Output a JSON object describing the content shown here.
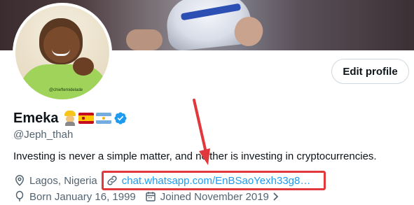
{
  "banner": {
    "description_icon": "banner-photo"
  },
  "avatar": {
    "watermark": "@chieftemidelade"
  },
  "edit_profile": {
    "label": "Edit profile"
  },
  "profile": {
    "name": "Emeka",
    "handle": "@Jeph_thah",
    "bio": "Investing is never a simple matter, and neither is investing in cryptocurrencies.",
    "location": "Lagos, Nigeria",
    "link": "chat.whatsapp.com/EnBSaoYexh33g8…",
    "birth": "Born January 16, 1999",
    "joined": "Joined November 2019"
  },
  "icons": {
    "worker": "construction-worker-emoji",
    "flag_1": "spain-flag",
    "flag_2": "argentina-flag",
    "verified": "verified-badge-icon",
    "location": "location-pin-icon",
    "link": "link-icon",
    "birth": "balloon-icon",
    "joined": "calendar-icon"
  },
  "colors": {
    "accent": "#1d9bf0",
    "secondary_text": "#536471",
    "annotation": "#e0383c",
    "shirt": "#9fd35a"
  }
}
